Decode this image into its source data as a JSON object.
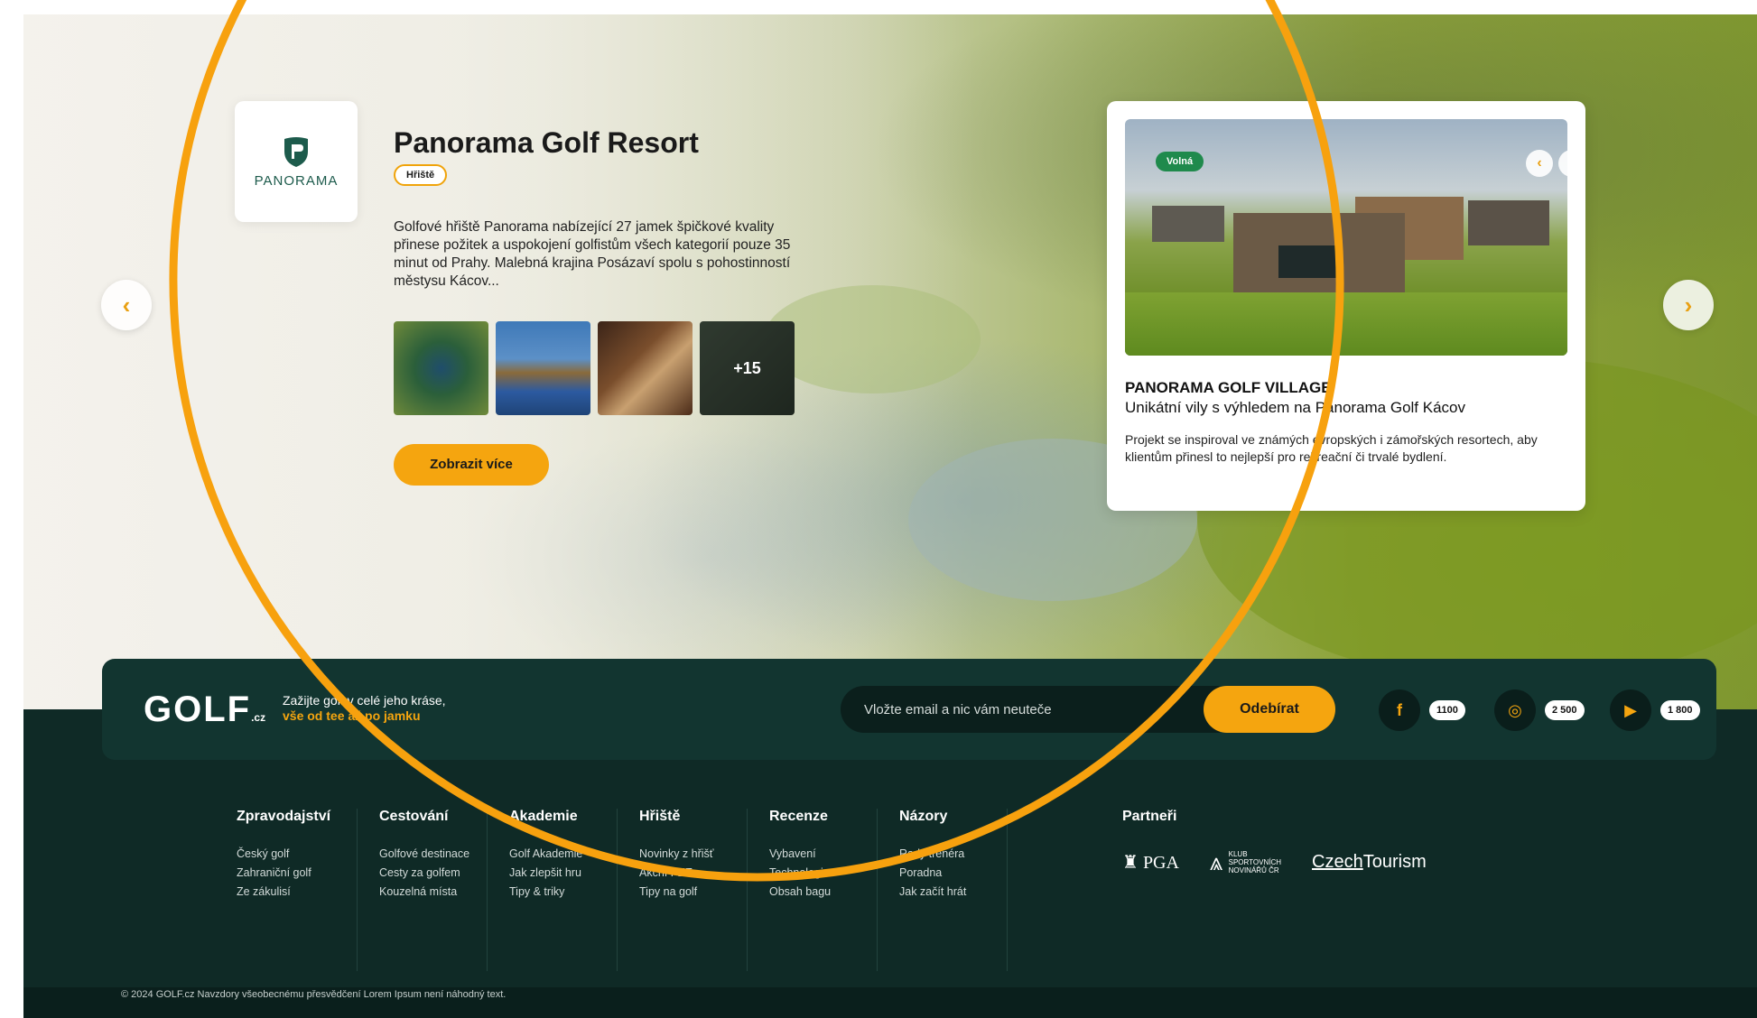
{
  "hero": {
    "prev_arrow": "‹",
    "next_arrow": "›",
    "logo_text": "PANORAMA",
    "resort_title": "Panorama Golf Resort",
    "resort_badge": "Hřiště",
    "resort_description": "Golfové hřiště Panorama nabízející 27 jamek špičkové kvality přinese požitek a uspokojení golfistům všech kategorií pouze 35 minut od Prahy. Malebná krajina Posázaví spolu s pohostinností městysu Kácov...",
    "gallery_more": "+15",
    "more_button": "Zobrazit více",
    "village": {
      "badge": "Volná",
      "title": "PANORAMA GOLF VILLAGE",
      "subtitle": "Unikátní vily s výhledem na Panorama Golf Kácov",
      "description": "Projekt se inspiroval ve známých evropských i zámořských resortech, aby klientům přinesl to nejlepší pro rekreační či trvalé bydlení."
    }
  },
  "newsletter": {
    "brand": "GOLF",
    "brand_suffix": ".cz",
    "tagline_line1": "Zažijte golf v celé jeho kráse,",
    "tagline_line2": "vše od tee až po jamku",
    "email_placeholder": "Vložte email a nic vám neuteče",
    "subscribe_button": "Odebírat",
    "social": [
      {
        "icon": "facebook-icon",
        "glyph": "f",
        "count": "1100"
      },
      {
        "icon": "instagram-icon",
        "glyph": "◎",
        "count": "2 500"
      },
      {
        "icon": "youtube-icon",
        "glyph": "▶",
        "count": "1 800"
      }
    ]
  },
  "footer": {
    "columns": [
      {
        "head": "Zpravodajství",
        "links": [
          "Český golf",
          "Zahraniční golf",
          "Ze zákulisí"
        ]
      },
      {
        "head": "Cestování",
        "links": [
          "Golfové destinace",
          "Cesty za golfem",
          "Kouzelná místa"
        ]
      },
      {
        "head": "Akademie",
        "links": [
          "Golf Akademie",
          "Jak zlepšit hru",
          "Tipy & triky"
        ]
      },
      {
        "head": "Hřiště",
        "links": [
          "Novinky z hřišť",
          "Akční FEE",
          "Tipy na golf"
        ]
      },
      {
        "head": "Recenze",
        "links": [
          "Vybavení",
          "Technologie",
          "Obsah bagu"
        ]
      },
      {
        "head": "Názory",
        "links": [
          "Rady trenéra",
          "Poradna",
          "Jak začít hrát"
        ]
      }
    ],
    "partners_head": "Partneři",
    "partners": {
      "pga": "PGA",
      "klub_line1": "KLUB",
      "klub_line2": "SPORTOVNÍCH",
      "klub_line3": "NOVINÁŘŮ ČR",
      "czech": "Czech",
      "tourism": "Tourism"
    },
    "copyright": "© 2024 GOLF.cz   Navzdory všeobecnému přesvědčení Lorem Ipsum není náhodný text."
  },
  "colors": {
    "accent": "#f5a50f",
    "footer_bg": "#0f2a26",
    "badge_green": "#1f8a4c",
    "annotation": "#f7a10e"
  }
}
